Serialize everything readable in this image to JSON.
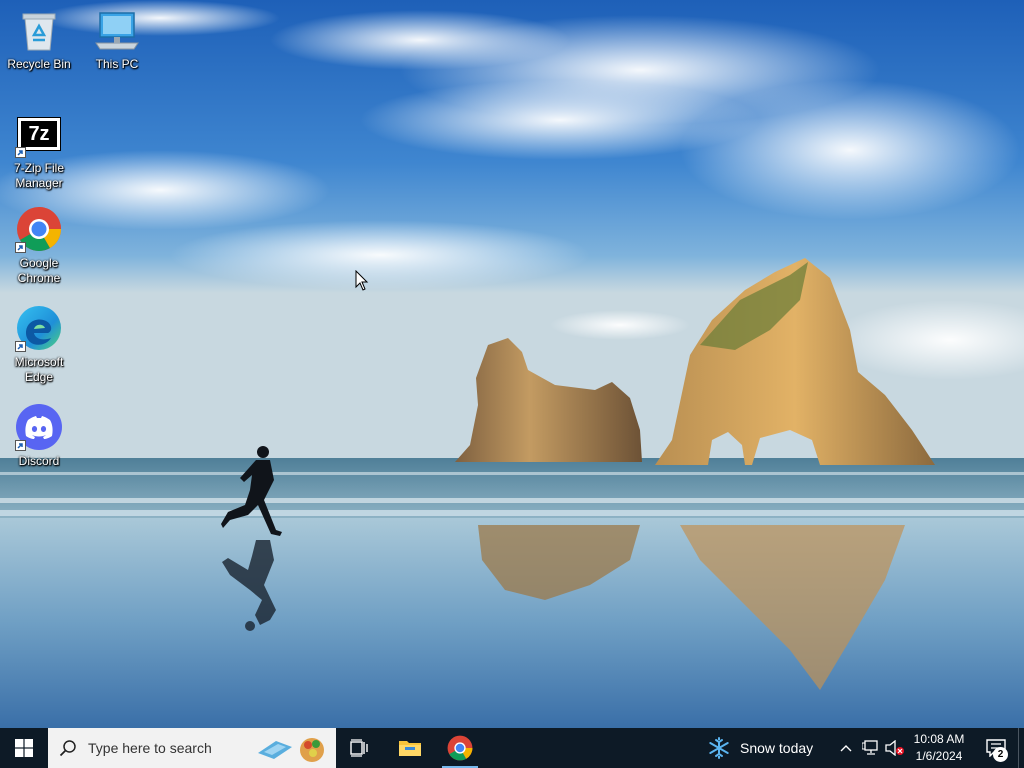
{
  "desktop": {
    "icons": [
      {
        "label": "Recycle Bin",
        "icon": "recycle-bin-icon"
      },
      {
        "label": "This PC",
        "icon": "computer-icon"
      },
      {
        "label": "7-Zip File Manager",
        "icon": "7zip-icon",
        "glyph": "7z"
      },
      {
        "label": "Google Chrome",
        "icon": "chrome-icon"
      },
      {
        "label": "Microsoft Edge",
        "icon": "edge-icon"
      },
      {
        "label": "Discord",
        "icon": "discord-icon"
      }
    ]
  },
  "taskbar": {
    "search_placeholder": "Type here to search",
    "pinned": [
      "file-explorer-icon",
      "chrome-icon"
    ],
    "weather": {
      "text": "Snow today",
      "icon": "snowflake-icon"
    },
    "clock": {
      "time": "10:08 AM",
      "date": "1/6/2024"
    },
    "notifications": {
      "count": "2"
    }
  },
  "colors": {
    "taskbar_bg": "#0d1a26",
    "search_bg": "#f2f2f2",
    "accent": "#76b9ed",
    "weather_icon": "#5ab4f0"
  }
}
